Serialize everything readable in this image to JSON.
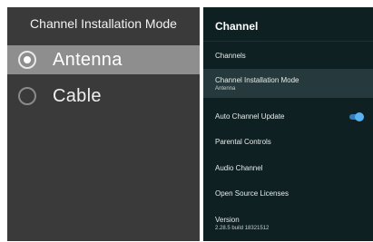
{
  "left": {
    "title": "Channel Installation Mode",
    "options": [
      {
        "label": "Antenna",
        "selected": true
      },
      {
        "label": "Cable",
        "selected": false
      }
    ]
  },
  "right": {
    "header": "Channel",
    "items": [
      {
        "label": "Channels"
      },
      {
        "label": "Channel Installation Mode",
        "sub": "Antenna"
      },
      {
        "label": "Auto Channel Update",
        "toggle": "on"
      },
      {
        "label": "Parental Controls"
      },
      {
        "label": "Audio Channel"
      },
      {
        "label": "Open Source Licenses"
      },
      {
        "label": "Version",
        "sub": "2.28.5 build 18321512"
      }
    ]
  },
  "colors": {
    "left_bg": "#3a3a3a",
    "left_selected": "#8e8e8e",
    "right_bg": "#0f2023",
    "right_selected": "#26393c",
    "toggle_accent": "#5ab2f0"
  },
  "icons": [
    "radio-selected-icon",
    "radio-unselected-icon",
    "toggle-switch-icon"
  ]
}
